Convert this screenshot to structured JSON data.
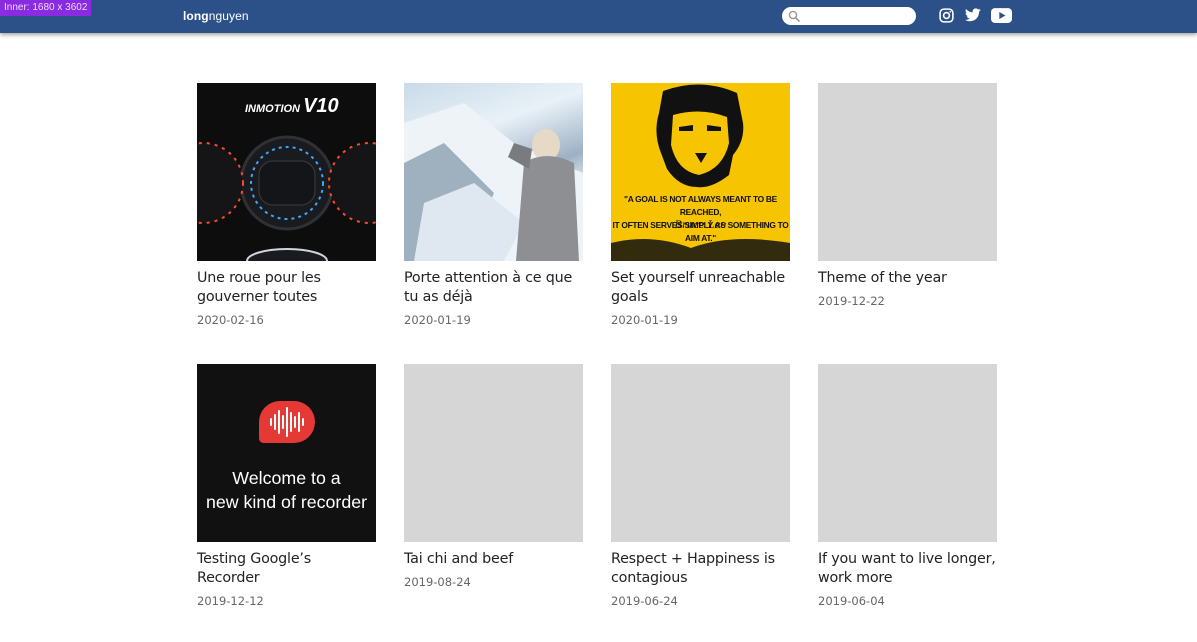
{
  "dev_badge": "Inner: 1680 x 3602",
  "header": {
    "logo_bold": "long",
    "logo_rest": "nguyen",
    "search_placeholder": "",
    "social": [
      "instagram-icon",
      "twitter-icon",
      "youtube-icon"
    ]
  },
  "colors": {
    "header_bg": "#2c5189",
    "placeholder": "#d6d6d6",
    "recorder_red": "#e53935",
    "poster_yellow": "#f6c400"
  },
  "posts": [
    {
      "title": "Une roue pour les gouverner toutes",
      "date": "2020-02-16",
      "thumb": {
        "brand": "INMOTION",
        "model": "V10"
      }
    },
    {
      "title": "Porte attention à ce que tu as déjà",
      "date": "2020-01-19"
    },
    {
      "title": "Set yourself unreachable goals",
      "date": "2020-01-19",
      "thumb": {
        "quote_line1": "\"A GOAL IS NOT ALWAYS MEANT TO BE REACHED,",
        "quote_line2": "IT OFTEN SERVES SIMPLY AS SOMETHING TO AIM AT.\"",
        "signature": "Bruce Lee"
      }
    },
    {
      "title": "Theme of the year",
      "date": "2019-12-22"
    },
    {
      "title": "Testing Google’s Recorder",
      "date": "2019-12-12",
      "thumb": {
        "line1": "Welcome to a",
        "line2": "new kind of recorder"
      }
    },
    {
      "title": "Tai chi and beef",
      "date": "2019-08-24"
    },
    {
      "title": "Respect + Happiness is contagious",
      "date": "2019-06-24"
    },
    {
      "title": "If you want to live longer, work more",
      "date": "2019-06-04"
    }
  ]
}
